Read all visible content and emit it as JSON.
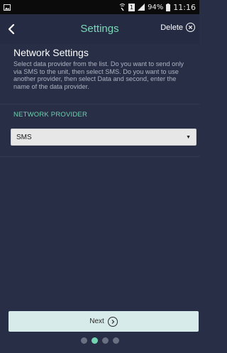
{
  "status_bar": {
    "battery_percent": "94%",
    "time": "11:16",
    "sim_badge": "1",
    "icons": [
      "image-icon",
      "wifi-call-icon",
      "sim-icon",
      "signal-icon",
      "battery-icon"
    ]
  },
  "header": {
    "title": "Settings",
    "delete_label": "Delete",
    "icons": [
      "back-arrow-icon",
      "close-circle-icon"
    ]
  },
  "content": {
    "heading": "Network Settings",
    "description": "Select data provider from the list. Do you want to send only via SMS to the unit, then select SMS. Do you want to use another provider, then select Data and second, enter the name of the data provider.",
    "section_label": "NETWORK PROVIDER",
    "provider_select": {
      "value": "SMS",
      "icon": "dropdown-arrow-icon"
    }
  },
  "footer": {
    "next_label": "Next",
    "next_icon": "chevron-right-circle-icon",
    "pagination": {
      "count": 4,
      "active_index": 1
    }
  },
  "colors": {
    "background": "#272e45",
    "accent": "#79d9b7",
    "next_button": "#d6ebea"
  }
}
